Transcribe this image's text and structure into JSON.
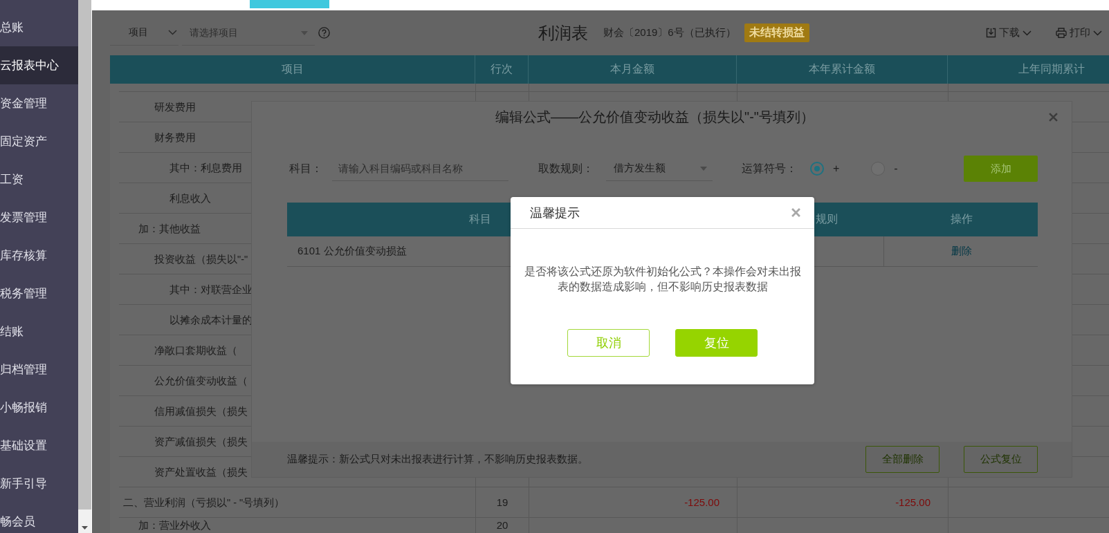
{
  "sidebar": {
    "items": [
      {
        "label": "总账",
        "selected": false
      },
      {
        "label": "云报表中心",
        "selected": true
      },
      {
        "label": "资金管理",
        "selected": false
      },
      {
        "label": "固定资产",
        "selected": false
      },
      {
        "label": "工资",
        "selected": false
      },
      {
        "label": "发票管理",
        "selected": false
      },
      {
        "label": "库存核算",
        "selected": false
      },
      {
        "label": "税务管理",
        "selected": false
      },
      {
        "label": "结账",
        "selected": false
      },
      {
        "label": "归档管理",
        "selected": false
      },
      {
        "label": "小畅报销",
        "selected": false
      },
      {
        "label": "基础设置",
        "selected": false
      },
      {
        "label": "新手引导",
        "selected": false
      },
      {
        "label": "畅会员",
        "selected": false
      }
    ]
  },
  "toolbar": {
    "filter_select": {
      "value": "项目"
    },
    "project_select": {
      "placeholder": "请选择项目"
    },
    "title": "利润表",
    "standard": "财会〔2019〕6号（已执行）",
    "badge": "未结转损益",
    "actions": [
      {
        "label": "下载",
        "kind": "download"
      },
      {
        "label": "打印",
        "kind": "print"
      }
    ]
  },
  "report_table": {
    "columns": [
      "项目",
      "行次",
      "本月金额",
      "本年累计金额",
      "上年同期累计"
    ],
    "rows": [
      {
        "label": "研发费用",
        "kind": "item"
      },
      {
        "label": "财务费用",
        "kind": "item"
      },
      {
        "label": "其中：利息费用",
        "kind": "detail"
      },
      {
        "label": "利息收入",
        "kind": "detail"
      },
      {
        "label": "加：其他收益",
        "kind": "group"
      },
      {
        "label": "投资收益（损失以\"-\"",
        "kind": "item"
      },
      {
        "label": "其中：对联营企业",
        "kind": "detail"
      },
      {
        "label": "以摊余成本计量的",
        "kind": "detail"
      },
      {
        "label": "净敞口套期收益（",
        "kind": "item"
      },
      {
        "label": "公允价值变动收益（",
        "kind": "item"
      },
      {
        "label": "信用减值损失（损失",
        "kind": "item"
      },
      {
        "label": "资产减值损失（损失",
        "kind": "item"
      },
      {
        "label": "资产处置收益（损失",
        "kind": "item"
      },
      {
        "label": "二、营业利润（亏损以\" - \"号填列）",
        "kind": "total",
        "line_no": "19",
        "current_month": "-125.00",
        "year_to_date": "-125.00"
      },
      {
        "label": "加：营业外收入",
        "kind": "group",
        "line_no": "20"
      }
    ]
  },
  "formula_dialog": {
    "title": "编辑公式——公允价值变动收益（损失以\"-\"号填列）",
    "subject_label": "科目：",
    "subject_field": {
      "placeholder": "请输入科目编码或科目名称"
    },
    "rule_label": "取数规则：",
    "rule_select": {
      "value": "借方发生额"
    },
    "operator_label": "运算符号：",
    "operators": [
      {
        "label": "+",
        "selected": true
      },
      {
        "label": "-",
        "selected": false
      }
    ],
    "add_button": "添加",
    "table": {
      "columns": [
        "科目",
        "规则",
        "操作"
      ],
      "rows": [
        {
          "subject": "6101 公允价值变动损益",
          "action": "删除"
        }
      ]
    },
    "note": "温馨提示：新公式只对未出报表进行计算，不影响历史报表数据。",
    "buttons": [
      "全部删除",
      "公式复位"
    ]
  },
  "alert": {
    "title": "温馨提示",
    "message": "是否将该公式还原为软件初始化公式？本操作会对未出报表的数据造成影响，但不影响历史报表数据",
    "buttons": [
      {
        "label": "取消",
        "kind": "secondary"
      },
      {
        "label": "复位",
        "kind": "primary"
      }
    ]
  }
}
